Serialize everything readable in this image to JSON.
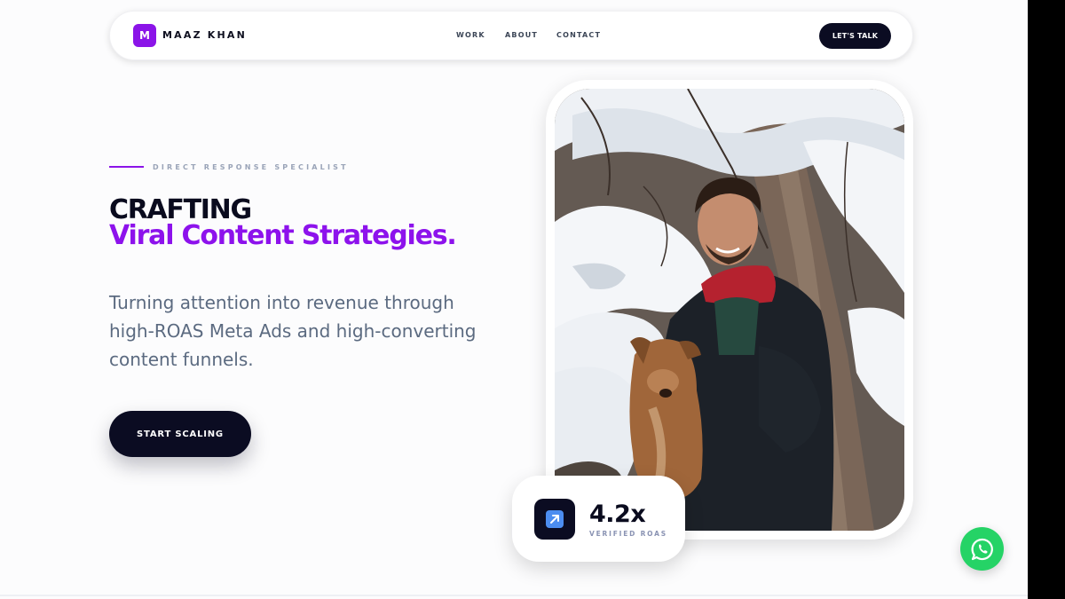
{
  "header": {
    "logo_letter": "M",
    "brand_name": "MAAZ KHAN",
    "nav": [
      "WORK",
      "ABOUT",
      "CONTACT"
    ],
    "cta_label": "LET'S TALK"
  },
  "hero": {
    "eyebrow": "DIRECT RESPONSE SPECIALIST",
    "title_line1": "CRAFTING",
    "title_line2": "Viral Content Strategies.",
    "description": "Turning attention into revenue through high-ROAS Meta Ads and high-converting content funnels.",
    "button_label": "START SCALING"
  },
  "stat": {
    "value": "4.2x",
    "label": "VERIFIED ROAS",
    "icon": "trend-arrow-icon"
  },
  "floating": {
    "icon": "whatsapp-icon"
  },
  "colors": {
    "accent": "#8d12ec",
    "dark": "#0b0c22",
    "whatsapp": "#25d366"
  }
}
